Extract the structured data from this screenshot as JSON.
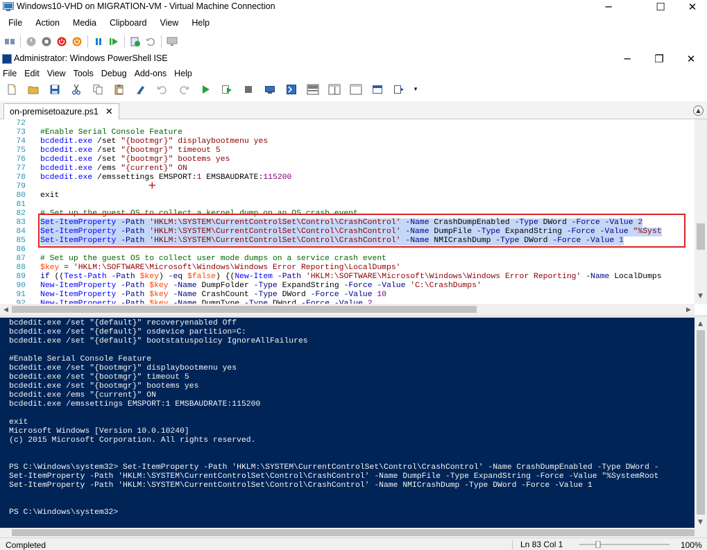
{
  "vm_window": {
    "title": "Windows10-VHD on MIGRATION-VM - Virtual Machine Connection",
    "menu": [
      "File",
      "Action",
      "Media",
      "Clipboard",
      "View",
      "Help"
    ],
    "toolbar_icons": [
      "ctrl-alt-del-icon",
      "start-icon",
      "turn-off-icon",
      "shut-down-icon",
      "save-icon",
      "pause-icon",
      "resume-icon",
      "checkpoint-icon",
      "revert-icon",
      "enhanced-session-icon"
    ]
  },
  "ise_window": {
    "title": "Administrator: Windows PowerShell ISE",
    "menu": [
      "File",
      "Edit",
      "View",
      "Tools",
      "Debug",
      "Add-ons",
      "Help"
    ]
  },
  "tabs": [
    {
      "label": "on-premisetoazure.ps1",
      "close": "✕"
    }
  ],
  "editor": {
    "lines": [
      {
        "n": "72",
        "code": ""
      },
      {
        "n": "73",
        "code": "#Enable Serial Console Feature"
      },
      {
        "n": "74",
        "code": "bcdedit.exe /set \"{bootmgr}\" displaybootmenu yes"
      },
      {
        "n": "75",
        "code": "bcdedit.exe /set \"{bootmgr}\" timeout 5"
      },
      {
        "n": "76",
        "code": "bcdedit.exe /set \"{bootmgr}\" bootems yes"
      },
      {
        "n": "77",
        "code": "bcdedit.exe /ems \"{current}\" ON"
      },
      {
        "n": "78",
        "code": "bcdedit.exe /emssettings EMSPORT:1 EMSBAUDRATE:115200"
      },
      {
        "n": "79",
        "code": ""
      },
      {
        "n": "80",
        "code": "exit"
      },
      {
        "n": "81",
        "code": ""
      },
      {
        "n": "82",
        "code": "# Set up the guest OS to collect a kernel dump on an OS crash event"
      },
      {
        "n": "83",
        "code": "Set-ItemProperty -Path 'HKLM:\\SYSTEM\\CurrentControlSet\\Control\\CrashControl' -Name CrashDumpEnabled -Type DWord -Force -Value 2"
      },
      {
        "n": "84",
        "code": "Set-ItemProperty -Path 'HKLM:\\SYSTEM\\CurrentControlSet\\Control\\CrashControl' -Name DumpFile -Type ExpandString -Force -Value \"%Syst"
      },
      {
        "n": "85",
        "code": "Set-ItemProperty -Path 'HKLM:\\SYSTEM\\CurrentControlSet\\Control\\CrashControl' -Name NMICrashDump -Type DWord -Force -Value 1"
      },
      {
        "n": "86",
        "code": ""
      },
      {
        "n": "87",
        "code": "# Set up the guest OS to collect user mode dumps on a service crash event"
      },
      {
        "n": "88",
        "code": "$key = 'HKLM:\\SOFTWARE\\Microsoft\\Windows\\Windows Error Reporting\\LocalDumps'"
      },
      {
        "n": "89",
        "code": "if ((Test-Path -Path $key) -eq $false) {(New-Item -Path 'HKLM:\\SOFTWARE\\Microsoft\\Windows\\Windows Error Reporting' -Name LocalDumps"
      },
      {
        "n": "90",
        "code": "New-ItemProperty -Path $key -Name DumpFolder -Type ExpandString -Force -Value 'C:\\CrashDumps'"
      },
      {
        "n": "91",
        "code": "New-ItemProperty -Path $key -Name CrashCount -Type DWord -Force -Value 10"
      },
      {
        "n": "92",
        "code": "New-ItemProperty -Path $key -Name DumpType -Type DWord -Force -Value 2"
      }
    ]
  },
  "console": {
    "lines": [
      "bcdedit.exe /set \"{default}\" recoveryenabled Off",
      "bcdedit.exe /set \"{default}\" osdevice partition=C:",
      "bcdedit.exe /set \"{default}\" bootstatuspolicy IgnoreAllFailures",
      "",
      "#Enable Serial Console Feature",
      "bcdedit.exe /set \"{bootmgr}\" displaybootmenu yes",
      "bcdedit.exe /set \"{bootmgr}\" timeout 5",
      "bcdedit.exe /set \"{bootmgr}\" bootems yes",
      "bcdedit.exe /ems \"{current}\" ON",
      "bcdedit.exe /emssettings EMSPORT:1 EMSBAUDRATE:115200",
      "",
      "exit",
      "Microsoft Windows [Version 10.0.10240]",
      "(c) 2015 Microsoft Corporation. All rights reserved.",
      "",
      "",
      "PS C:\\Windows\\system32> Set-ItemProperty -Path 'HKLM:\\SYSTEM\\CurrentControlSet\\Control\\CrashControl' -Name CrashDumpEnabled -Type DWord -",
      "Set-ItemProperty -Path 'HKLM:\\SYSTEM\\CurrentControlSet\\Control\\CrashControl' -Name DumpFile -Type ExpandString -Force -Value \"%SystemRoot",
      "Set-ItemProperty -Path 'HKLM:\\SYSTEM\\CurrentControlSet\\Control\\CrashControl' -Name NMICrashDump -Type DWord -Force -Value 1",
      "",
      "",
      "PS C:\\Windows\\system32>"
    ]
  },
  "status": {
    "text": "Completed",
    "position": "Ln 83  Col 1",
    "zoom": "100%"
  },
  "colors": {
    "console_bg": "#012456",
    "selection": "#c5d7f7",
    "annotation_box": "#d92121"
  }
}
